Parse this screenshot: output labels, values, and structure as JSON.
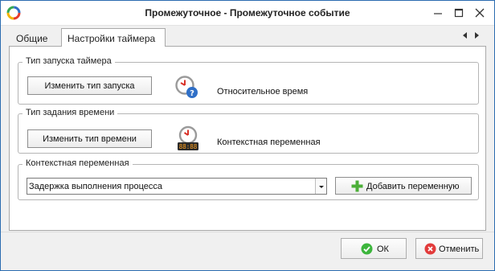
{
  "window": {
    "title": "Промежуточное - Промежуточное событие"
  },
  "tabs": [
    {
      "label": "Общие"
    },
    {
      "label": "Настройки таймера",
      "active": true
    }
  ],
  "timer_start": {
    "legend": "Тип запуска таймера",
    "button_label": "Изменить тип запуска",
    "value": "Относительное время"
  },
  "time_setting": {
    "legend": "Тип задания времени",
    "button_label": "Изменить тип времени",
    "value": "Контекстная переменная"
  },
  "context_variable": {
    "legend": "Контекстная переменная",
    "selected": "Задержка выполнения процесса",
    "add_button_label": "Добавить переменную"
  },
  "footer": {
    "ok_label": "ОК",
    "cancel_label": "Отменить"
  },
  "colors": {
    "window_border": "#2b6cb0",
    "ok_green": "#3cb53c",
    "cancel_red": "#e23b3b",
    "add_green": "#4caf38",
    "clock_red": "#d9342b",
    "help_blue": "#2f6fc7"
  },
  "icons": {
    "app": "app-logo-icon",
    "minimize": "minimize-icon",
    "maximize": "maximize-icon",
    "close": "close-icon",
    "relative_time": "clock-question-icon",
    "context_time": "clock-digital-icon",
    "add": "plus-icon",
    "ok": "check-circle-icon",
    "cancel": "cancel-circle-icon"
  }
}
